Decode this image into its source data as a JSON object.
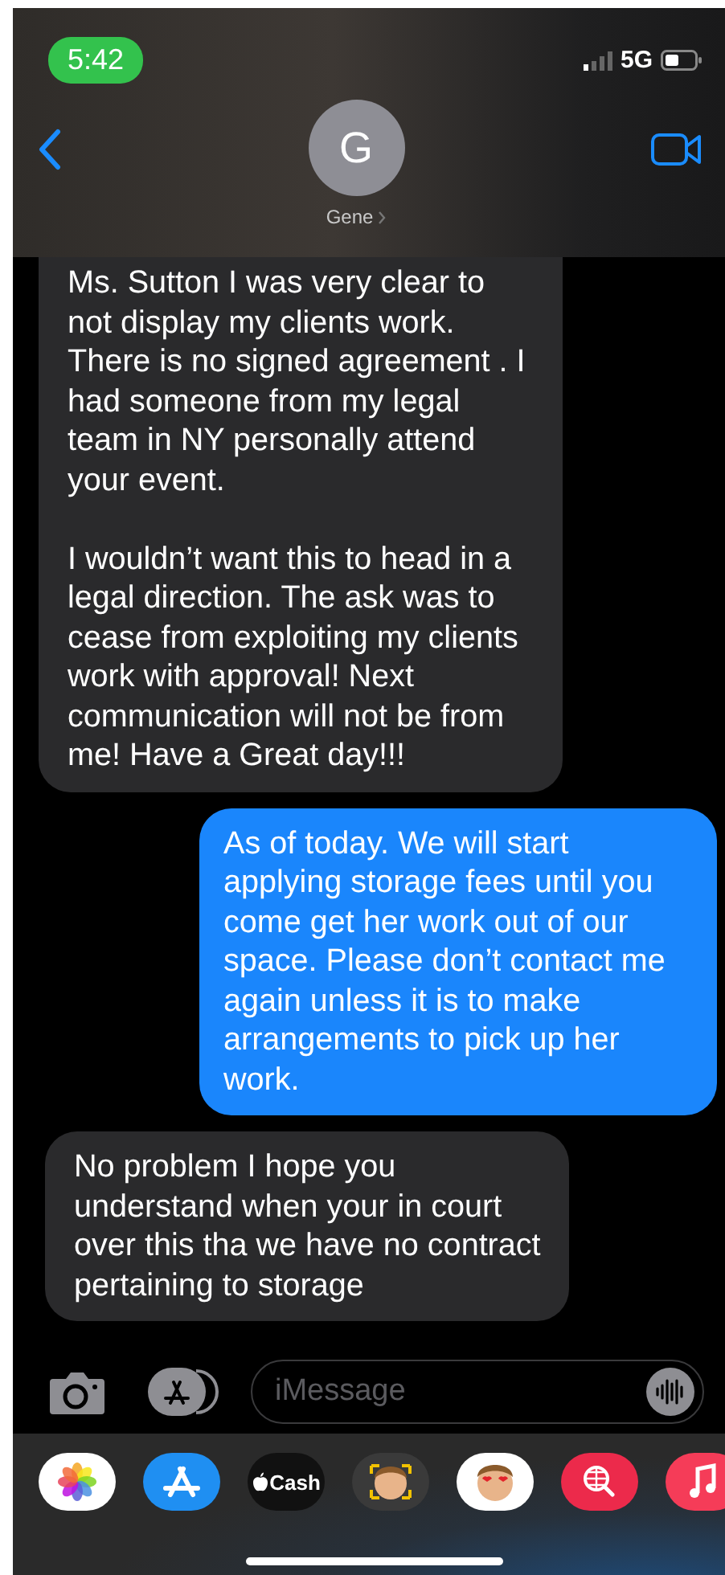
{
  "status_bar": {
    "time": "5:42",
    "network": "5G"
  },
  "header": {
    "avatar_initial": "G",
    "contact_name": "Gene"
  },
  "messages": [
    {
      "kind": "received",
      "text": "Ms. Sutton I was very clear to not display my clients work. There is no signed agreement . I had someone from my legal team in NY personally attend your event.\n\nI wouldn’t want this to head in a legal direction. The ask was to cease from exploiting my clients work with approval! Next communication will not be from me! Have a Great day!!!"
    },
    {
      "kind": "sent",
      "text": "As of today. We will start applying storage fees until you come get her work out of our space. Please don’t contact me again unless it is to make arrangements to pick up her work."
    },
    {
      "kind": "received",
      "text": "No problem I hope you understand when your in court over this tha we have no contract pertaining to storage"
    }
  ],
  "composer": {
    "placeholder": "iMessage"
  },
  "app_drawer": {
    "apps": [
      {
        "kind": "photos"
      },
      {
        "kind": "app-store"
      },
      {
        "kind": "cash",
        "label": "Cash"
      },
      {
        "kind": "memoji"
      },
      {
        "kind": "memoji-stickers"
      },
      {
        "kind": "web-search"
      },
      {
        "kind": "music"
      }
    ]
  }
}
